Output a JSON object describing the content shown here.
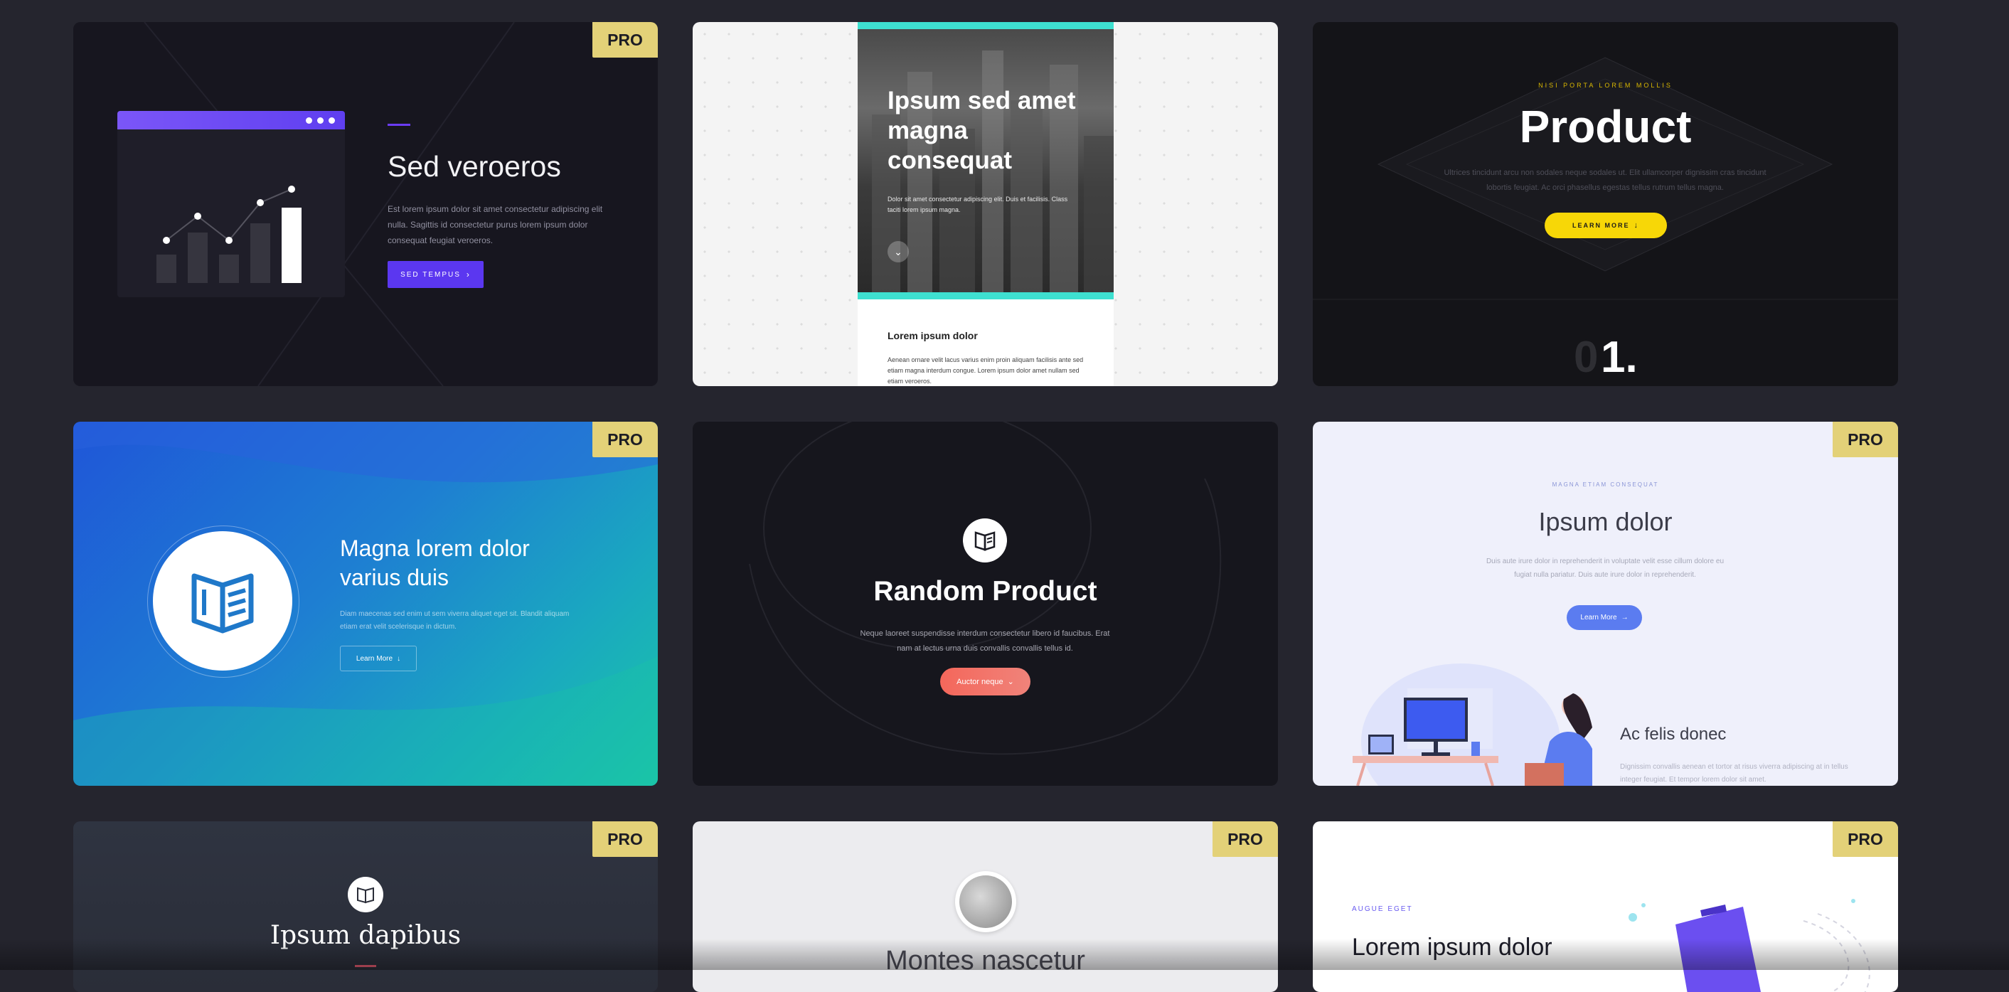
{
  "pro_badge": "PRO",
  "card1": {
    "title": "Sed veroeros",
    "body": "Est lorem ipsum dolor sit amet consectetur adipiscing elit nulla. Sagittis id consectetur purus lorem ipsum dolor consequat feugiat veroeros.",
    "button": "SED TEMPUS",
    "accent": "#6b3cf5"
  },
  "card2": {
    "hero_title": "Ipsum sed amet magna consequat",
    "hero_body": "Dolor sit amet consectetur adipiscing elit. Duis et facilisis. Class taciti lorem ipsum magna.",
    "section_title": "Lorem ipsum dolor",
    "section_body": "Aenean ornare velit lacus varius enim proin aliquam facilisis ante sed etiam magna interdum congue. Lorem ipsum dolor amet nullam sed etiam veroeros.",
    "accent": "#3ee0d0"
  },
  "card3": {
    "kicker": "NISI PORTA LOREM MOLLIS",
    "title": "Product",
    "body": "Ultrices tincidunt arcu non sodales neque sodales ut. Elit ullamcorper dignissim cras tincidunt lobortis feugiat. Ac orci phasellus egestas tellus rutrum tellus magna.",
    "button": "LEARN MORE",
    "number_faded": "0",
    "number": "1.",
    "accent": "#f5d60a"
  },
  "card4": {
    "title": "Magna lorem dolor varius duis",
    "body": "Diam maecenas sed enim ut sem viverra aliquet eget sit. Blandit aliquam etiam erat velit scelerisque in dictum.",
    "button": "Learn More"
  },
  "card5": {
    "title": "Random Product",
    "body": "Neque laoreet suspendisse interdum consectetur libero id faucibus. Erat nam at lectus urna duis convallis convallis tellus id.",
    "button": "Auctor neque",
    "accent": "#f4675b"
  },
  "card6": {
    "kicker": "MAGNA ETIAM CONSEQUAT",
    "title": "Ipsum dolor",
    "body": "Duis aute irure dolor in reprehenderit in voluptate velit esse cillum dolore eu fugiat nulla pariatur. Duis aute irure dolor in reprehenderit.",
    "button": "Learn More",
    "subtitle": "Ac felis donec",
    "subbody": "Dignissim convallis aenean et tortor at risus viverra adipiscing at in tellus integer feugiat. Et tempor lorem dolor sit amet.",
    "accent": "#5b7cf0"
  },
  "card7": {
    "title": "Ipsum dapibus"
  },
  "card8": {
    "title": "Montes nascetur"
  },
  "card9": {
    "kicker": "AUGUE EGET",
    "title": "Lorem ipsum dolor"
  }
}
